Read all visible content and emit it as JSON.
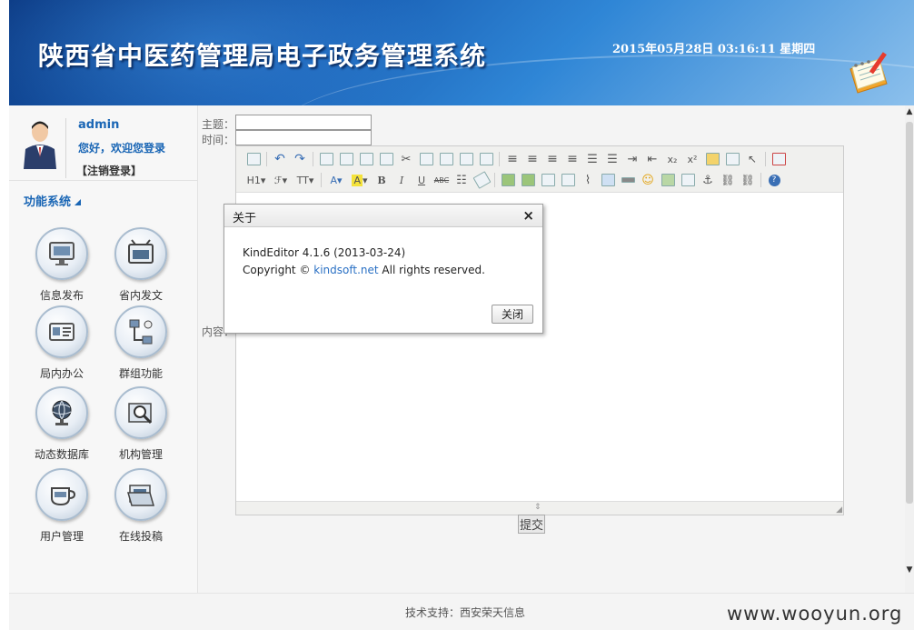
{
  "header": {
    "title": "陕西省中医药管理局电子政务管理系统",
    "datetime": "2015年05月28日 03:16:11 星期四"
  },
  "user": {
    "name": "admin",
    "welcome": "您好，欢迎您登录",
    "logout_label": "【注销登录】"
  },
  "menu": {
    "title": "功能系统",
    "items": [
      {
        "label": "信息发布",
        "icon": "monitor-icon"
      },
      {
        "label": "省内发文",
        "icon": "tv-document-icon"
      },
      {
        "label": "局内办公",
        "icon": "id-card-icon"
      },
      {
        "label": "群组功能",
        "icon": "network-icon"
      },
      {
        "label": "动态数据库",
        "icon": "globe-icon"
      },
      {
        "label": "机构管理",
        "icon": "magnifier-folder-icon"
      },
      {
        "label": "用户管理",
        "icon": "cup-icon"
      },
      {
        "label": "在线投稿",
        "icon": "folder-icon"
      }
    ]
  },
  "form": {
    "subject_label": "主题：",
    "time_label": "时间：",
    "subject_value": "",
    "time_value": "",
    "content_label": "内容：",
    "submit_label": "提交"
  },
  "dialog": {
    "title": "关于",
    "close_glyph": "×",
    "version_line": "KindEditor 4.1.6 (2013-03-24)",
    "copyright_prefix": "Copyright © ",
    "copyright_link": "kindsoft.net",
    "copyright_suffix": " All rights reserved.",
    "button_label": "关闭"
  },
  "footer": {
    "support": "技术支持：西安荣天信息",
    "watermark": "www.wooyun.org"
  },
  "toolbar": {
    "heading_label": "H1",
    "font_label": "ℱ",
    "size_label": "TT",
    "color_label": "A",
    "bold_label": "B",
    "italic_label": "I",
    "underline_label": "U",
    "strike_label": "ABC"
  }
}
